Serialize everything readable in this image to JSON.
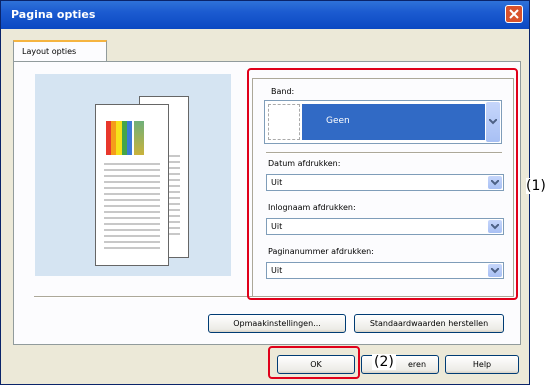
{
  "window": {
    "title": "Pagina opties"
  },
  "tabs": [
    {
      "label": "Layout opties"
    }
  ],
  "band": {
    "label": "Band:",
    "selected": "Geen"
  },
  "fields": [
    {
      "label": "Datum afdrukken:",
      "value": "Uit"
    },
    {
      "label": "Inlognaam afdrukken:",
      "value": "Uit"
    },
    {
      "label": "Paginanummer afdrukken:",
      "value": "Uit"
    }
  ],
  "buttons": {
    "formatting": "Opmaakinstellingen...",
    "restore_defaults": "Standaardwaarden herstellen",
    "ok": "OK",
    "cancel": "Annuleren",
    "cancel_visible": "eren",
    "help": "Help"
  },
  "callouts": {
    "one": "(1)",
    "two": "(2)"
  },
  "colors": {
    "highlight": "#e0001a",
    "titlebar": "#0b48c2",
    "selection": "#316ac5"
  }
}
